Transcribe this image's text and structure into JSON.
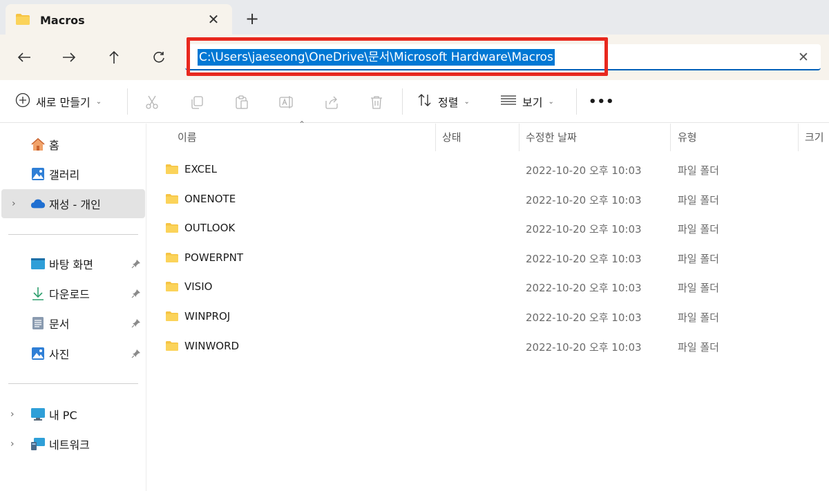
{
  "tab": {
    "title": "Macros"
  },
  "address": {
    "path": "C:\\Users\\jaeseong\\OneDrive\\문서\\Microsoft Hardware\\Macros"
  },
  "command_bar": {
    "new_label": "새로 만들기",
    "sort_label": "정렬",
    "view_label": "보기",
    "more_label": "•••"
  },
  "sidebar": {
    "items": [
      {
        "label": "홈",
        "icon": "home-icon"
      },
      {
        "label": "갤러리",
        "icon": "gallery-icon"
      },
      {
        "label": "재성 - 개인",
        "icon": "onedrive-cloud-icon"
      },
      {
        "label": "바탕 화면",
        "icon": "desktop-icon"
      },
      {
        "label": "다운로드",
        "icon": "download-icon"
      },
      {
        "label": "문서",
        "icon": "document-icon"
      },
      {
        "label": "사진",
        "icon": "pictures-icon"
      },
      {
        "label": "내 PC",
        "icon": "pc-icon"
      },
      {
        "label": "네트워크",
        "icon": "network-icon"
      }
    ]
  },
  "columns": {
    "name": "이름",
    "status": "상태",
    "modified": "수정한 날짜",
    "type": "유형",
    "size": "크기"
  },
  "files": [
    {
      "name": "EXCEL",
      "modified": "2022-10-20 오후 10:03",
      "type": "파일 폴더"
    },
    {
      "name": "ONENOTE",
      "modified": "2022-10-20 오후 10:03",
      "type": "파일 폴더"
    },
    {
      "name": "OUTLOOK",
      "modified": "2022-10-20 오후 10:03",
      "type": "파일 폴더"
    },
    {
      "name": "POWERPNT",
      "modified": "2022-10-20 오후 10:03",
      "type": "파일 폴더"
    },
    {
      "name": "VISIO",
      "modified": "2022-10-20 오후 10:03",
      "type": "파일 폴더"
    },
    {
      "name": "WINPROJ",
      "modified": "2022-10-20 오후 10:03",
      "type": "파일 폴더"
    },
    {
      "name": "WINWORD",
      "modified": "2022-10-20 오후 10:03",
      "type": "파일 폴더"
    }
  ],
  "colors": {
    "accent": "#0078d4",
    "highlight_box": "#e8281e",
    "folder": "#f6c444"
  }
}
